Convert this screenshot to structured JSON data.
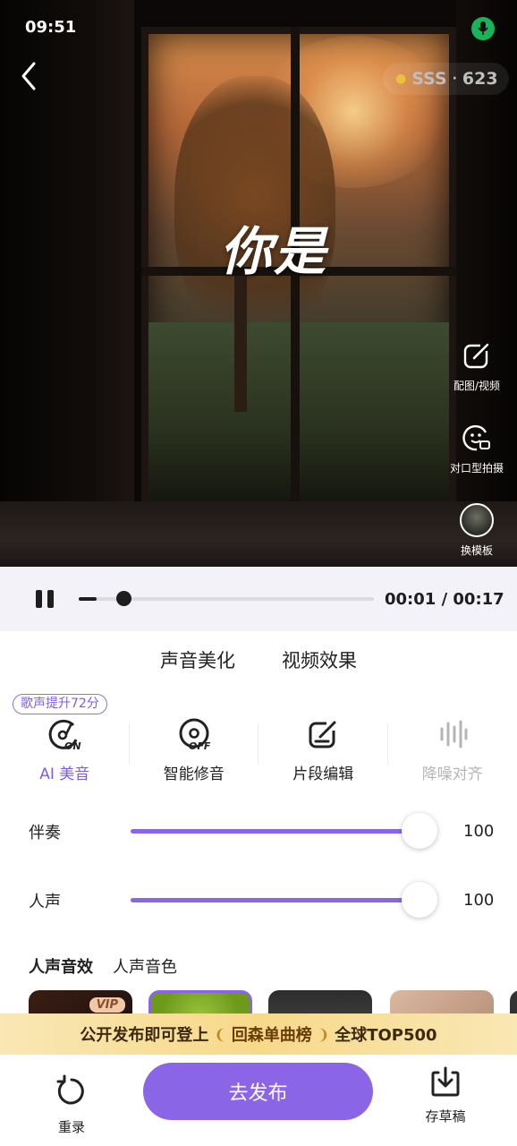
{
  "status_bar": {
    "time": "09:51"
  },
  "video": {
    "lyric": "你是",
    "score": {
      "label": "SSS",
      "separator": "·",
      "value": "623"
    },
    "side_tools": [
      {
        "label": "配图/视频",
        "icon": "edit-image-icon"
      },
      {
        "label": "对口型拍摄",
        "icon": "lip-sync-camera-icon"
      },
      {
        "label": "换模板",
        "icon": "template-thumbnail"
      }
    ]
  },
  "player": {
    "progress_fraction": 0.06,
    "time": "00:01 / 00:17",
    "current": "00:01",
    "total": "00:17"
  },
  "main_tabs": [
    {
      "label": "声音美化",
      "active": true
    },
    {
      "label": "视频效果",
      "active": false
    }
  ],
  "promo_badge": "歌声提升72分",
  "tools": [
    {
      "label": "AI 美音",
      "icon": "ai-beauty-on-icon",
      "state": "active"
    },
    {
      "label": "智能修音",
      "icon": "auto-tune-off-icon",
      "state": "normal"
    },
    {
      "label": "片段编辑",
      "icon": "clip-edit-icon",
      "state": "normal"
    },
    {
      "label": "降噪对齐",
      "icon": "noise-reduction-icon",
      "state": "disabled"
    }
  ],
  "sliders": [
    {
      "label": "伴奏",
      "value": "100",
      "fraction": 1.0
    },
    {
      "label": "人声",
      "value": "100",
      "fraction": 1.0
    }
  ],
  "effect_tabs": [
    {
      "label": "人声音效",
      "active": true
    },
    {
      "label": "人声音色",
      "active": false
    }
  ],
  "effect_thumbs": [
    {
      "tag": "VIP"
    },
    {
      "tag": ""
    },
    {
      "tag": ""
    },
    {
      "tag": ""
    },
    {
      "tag": ""
    }
  ],
  "banner": {
    "prefix": "公开发布即可登上",
    "rank_name": "回森单曲榜",
    "suffix": "全球TOP500"
  },
  "bottom": {
    "rerecord_label": "重录",
    "publish_label": "去发布",
    "draft_label": "存草稿"
  },
  "colors": {
    "accent": "#8a66e6",
    "highlight": "#ffd93b",
    "mic_green": "#19b35a"
  }
}
